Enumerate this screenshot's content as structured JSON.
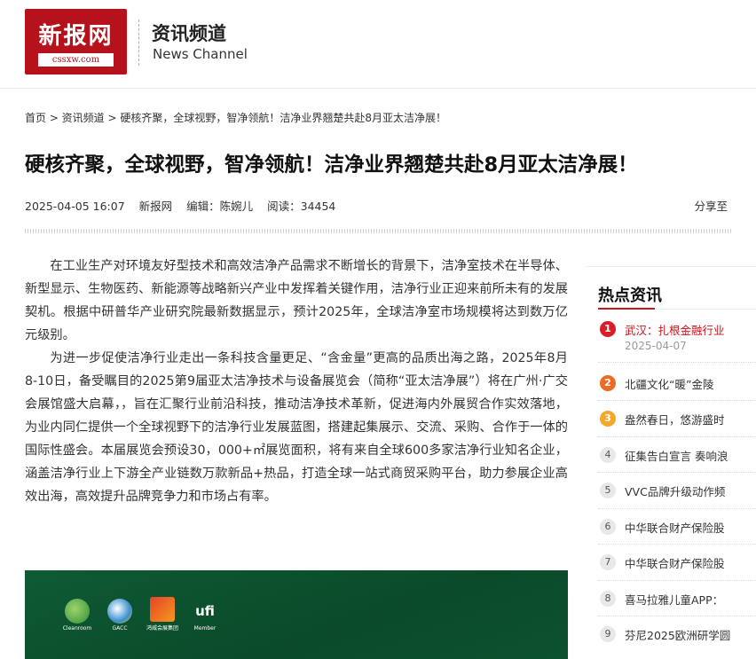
{
  "site": {
    "logo_cn": "新报网",
    "logo_en": "cssxw.com",
    "channel_cn": "资讯频道",
    "channel_en": "News Channel"
  },
  "breadcrumb": "首页 > 资讯频道 > 硬核齐聚，全球视野，智净领航！洁净业界翘楚共赴8月亚太洁净展！",
  "article": {
    "title": "硬核齐聚，全球视野，智净领航！洁净业界翘楚共赴8月亚太洁净展！",
    "date": "2025-04-05 16:07",
    "source": "新报网",
    "editor": "编辑：陈婉儿",
    "reads": "阅读：34454",
    "share": "分享至",
    "paragraphs": [
      "在工业生产对环境友好型技术和高效洁净产品需求不断增长的背景下，洁净室技术在半导体、新型显示、生物医药、新能源等战略新兴产业中发挥着关键作用，洁净行业正迎来前所未有的发展契机。根据中研普华产业研究院最新数据显示，预计2025年，全球洁净室市场规模将达到数万亿元级别。",
      "为进一步促使洁净行业走出一条科技含量更足、“含金量”更高的品质出海之路，2025年8月8-10日，备受瞩目的2025第9届亚太洁净技术与设备展览会（简称“亚太洁净展”）将在广州·广交会展馆盛大启幕，，旨在汇聚行业前沿科技，推动洁净技术革新，促进海内外展贸合作实效落地，为业内同仁提供一个全球视野下的洁净行业发展蓝图，搭建起集展示、交流、采购、合作于一体的国际性盛会。本届展览会预设30，000+㎡展览面积，将有来自全球600多家洁净行业知名企业，涵盖洁净行业上下游全产业链数万款新品+热品，打造全球一站式商贸采购平台，助力参展企业高效出海，高效提升品牌竞争力和市场占有率。"
    ]
  },
  "banner": {
    "logos": [
      "Cleanroom",
      "GACC",
      "鸿威会展集团",
      "Member"
    ],
    "ufi_text": "ufi"
  },
  "sidebar": {
    "title": "热点资讯",
    "items": [
      {
        "num": "1",
        "text": "武汉：扎根金融行业",
        "date": "2025-04-07"
      },
      {
        "num": "2",
        "text": "北疆文化“暖”金陵"
      },
      {
        "num": "3",
        "text": "盎然春日，悠游盛时"
      },
      {
        "num": "4",
        "text": "征集告白宣言 奏响浪"
      },
      {
        "num": "5",
        "text": "VVC品牌升级动作频"
      },
      {
        "num": "6",
        "text": "中华联合财产保险股"
      },
      {
        "num": "7",
        "text": "中华联合财产保险股"
      },
      {
        "num": "8",
        "text": "喜马拉雅儿童APP："
      },
      {
        "num": "9",
        "text": "芬尼2025欧洲研学圆"
      }
    ]
  }
}
